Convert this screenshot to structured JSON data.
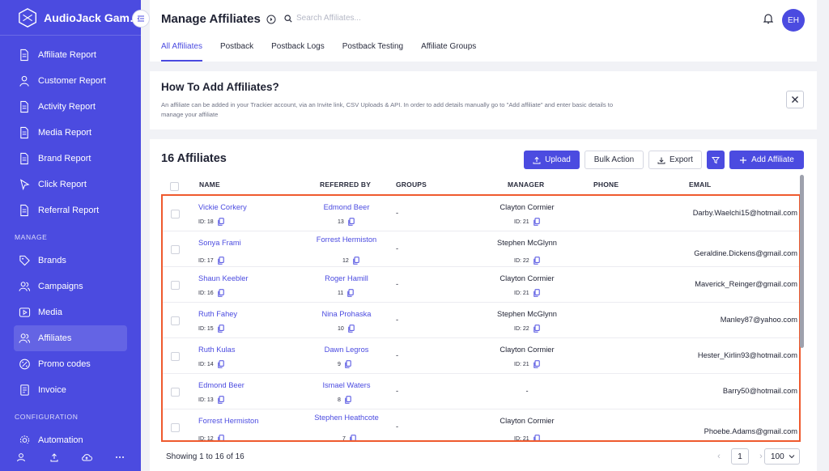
{
  "app": {
    "name": "AudioJack Gam…"
  },
  "sidebar": {
    "items": [
      {
        "label": "Affiliate Report",
        "icon": "document-icon"
      },
      {
        "label": "Customer Report",
        "icon": "user-icon"
      },
      {
        "label": "Activity Report",
        "icon": "document-icon"
      },
      {
        "label": "Media Report",
        "icon": "document-icon"
      },
      {
        "label": "Brand Report",
        "icon": "document-icon"
      },
      {
        "label": "Click Report",
        "icon": "cursor-icon"
      },
      {
        "label": "Referral Report",
        "icon": "document-icon"
      }
    ],
    "manage_label": "MANAGE",
    "manage_items": [
      {
        "label": "Brands",
        "icon": "tag-icon"
      },
      {
        "label": "Campaigns",
        "icon": "users-icon"
      },
      {
        "label": "Media",
        "icon": "play-icon"
      },
      {
        "label": "Affiliates",
        "icon": "users-icon",
        "active": true
      },
      {
        "label": "Promo codes",
        "icon": "percent-icon"
      },
      {
        "label": "Invoice",
        "icon": "file-icon"
      }
    ],
    "config_label": "CONFIGURATION",
    "config_items": [
      {
        "label": "Automation",
        "icon": "gear-icon"
      }
    ]
  },
  "header": {
    "title": "Manage Affiliates",
    "search_placeholder": "Search Affiliates...",
    "avatar": "EH",
    "tabs": [
      "All Affiliates",
      "Postback",
      "Postback Logs",
      "Postback Testing",
      "Affiliate Groups"
    ],
    "active_tab": 0
  },
  "info": {
    "title": "How To Add Affiliates?",
    "text": "An affiliate can be added in your Trackier account, via an Invite link, CSV Uploads & API. In order to add details manually go to \"Add affiliate\" and enter basic details to manage your affiliate"
  },
  "table": {
    "title": "16 Affiliates",
    "buttons": {
      "upload": "Upload",
      "bulk": "Bulk Action",
      "export": "Export",
      "add": "Add Affiliate"
    },
    "columns": [
      "NAME",
      "REFERRED BY",
      "GROUPS",
      "MANAGER",
      "PHONE",
      "EMAIL"
    ],
    "rows": [
      {
        "name": "Vickie Corkery",
        "id": "ID: 18",
        "ref": "Edmond Beer",
        "ref_id": "13",
        "groups": "-",
        "manager": "Clayton Cormier",
        "mgr_id": "ID: 21",
        "email": "Darby.Waelchi15@hotmail.com"
      },
      {
        "name": "Sonya Frami",
        "id": "ID: 17",
        "ref": "Forrest Hermiston",
        "ref_id": "12",
        "groups": "-",
        "manager": "Stephen McGlynn",
        "mgr_id": "ID: 22",
        "email": "Geraldine.Dickens@gmail.com"
      },
      {
        "name": "Shaun Keebler",
        "id": "ID: 16",
        "ref": "Roger Hamill",
        "ref_id": "11",
        "groups": "-",
        "manager": "Clayton Cormier",
        "mgr_id": "ID: 21",
        "email": "Maverick_Reinger@gmail.com"
      },
      {
        "name": "Ruth Fahey",
        "id": "ID: 15",
        "ref": "Nina Prohaska",
        "ref_id": "10",
        "groups": "-",
        "manager": "Stephen McGlynn",
        "mgr_id": "ID: 22",
        "email": "Manley87@yahoo.com"
      },
      {
        "name": "Ruth Kulas",
        "id": "ID: 14",
        "ref": "Dawn Legros",
        "ref_id": "9",
        "groups": "-",
        "manager": "Clayton Cormier",
        "mgr_id": "ID: 21",
        "email": "Hester_Kirlin93@hotmail.com"
      },
      {
        "name": "Edmond Beer",
        "id": "ID: 13",
        "ref": "Ismael Waters",
        "ref_id": "8",
        "groups": "-",
        "manager": "-",
        "mgr_id": "",
        "email": "Barry50@hotmail.com"
      },
      {
        "name": "Forrest Hermiston",
        "id": "ID: 12",
        "ref": "Stephen Heathcote",
        "ref_id": "7",
        "groups": "-",
        "manager": "Clayton Cormier",
        "mgr_id": "ID: 21",
        "email": "Phoebe.Adams@gmail.com"
      }
    ],
    "showing": "Showing 1 to 16 of 16",
    "page": "1",
    "per_page": "100"
  },
  "colors": {
    "accent": "#4b4be0",
    "highlight": "#ef5a2e"
  }
}
